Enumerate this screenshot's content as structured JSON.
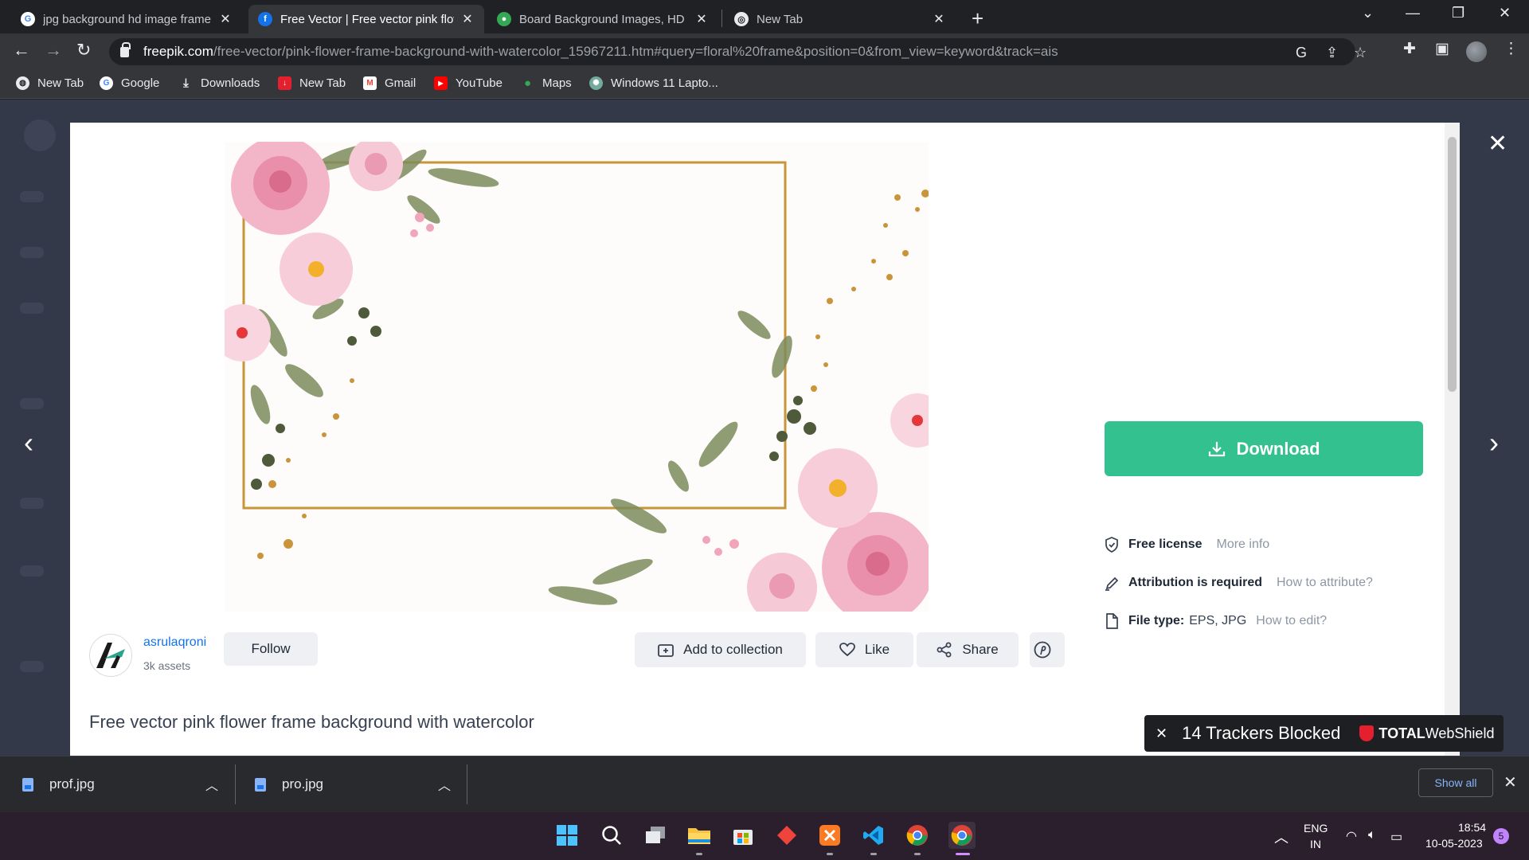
{
  "browser": {
    "tabs": [
      {
        "title": "jpg background hd image frame",
        "active": false
      },
      {
        "title": "Free Vector | Free vector pink flow",
        "active": true
      },
      {
        "title": "Board Background Images, HD Pi",
        "active": false
      },
      {
        "title": "New Tab",
        "active": false
      }
    ],
    "url": {
      "host": "freepik.com",
      "path": "/free-vector/pink-flower-frame-background-with-watercolor_15967211.htm#query=floral%20frame&position=0&from_view=keyword&track=ais"
    },
    "bookmarks": [
      {
        "label": "New Tab",
        "icon": "globe-icon"
      },
      {
        "label": "Google",
        "icon": "google-icon"
      },
      {
        "label": "Downloads",
        "icon": "download-icon"
      },
      {
        "label": "New Tab",
        "icon": "bookmark-red-icon"
      },
      {
        "label": "Gmail",
        "icon": "gmail-icon"
      },
      {
        "label": "YouTube",
        "icon": "youtube-icon"
      },
      {
        "label": "Maps",
        "icon": "maps-icon"
      },
      {
        "label": "Windows 11 Lapto...",
        "icon": "openai-icon"
      }
    ]
  },
  "asset": {
    "author_name": "asrulaqroni",
    "author_assets": "3k assets",
    "follow_label": "Follow",
    "title": "Free vector pink flower frame background with watercolor",
    "actions": {
      "add_to_collection": "Add to collection",
      "like": "Like",
      "share": "Share"
    },
    "download_label": "Download",
    "license_label": "Free license",
    "license_link": "More info",
    "attribution_label": "Attribution is required",
    "attribution_link": "How to attribute?",
    "filetype_label": "File type:",
    "filetype_value": "EPS, JPG",
    "filetype_link": "How to edit?"
  },
  "tracker_toast": {
    "count_text": "14 Trackers Blocked",
    "brand_bold": "TOTAL",
    "brand_rest": "WebShield"
  },
  "downloads": {
    "items": [
      "prof.jpg",
      "pro.jpg"
    ],
    "show_all": "Show all"
  },
  "taskbar": {
    "language": "ENG",
    "region": "IN",
    "time": "18:54",
    "date": "10-05-2023",
    "notifications": "5"
  },
  "colors": {
    "download_green": "#33c18f",
    "link_blue": "#1273eb",
    "toast_red": "#e5202e"
  }
}
